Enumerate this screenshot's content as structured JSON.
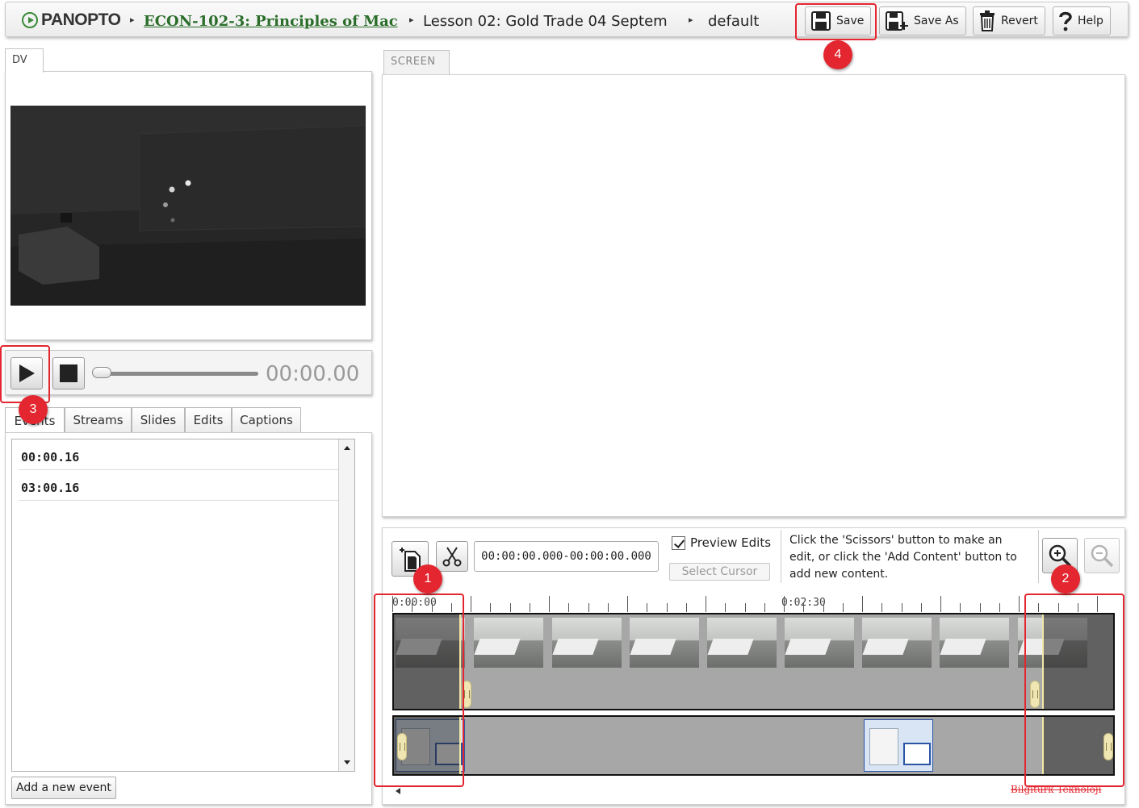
{
  "header": {
    "logo_text": "PANOPTO",
    "breadcrumb_course": "ECON-102-3: Principles of Mac",
    "breadcrumb_lesson": "Lesson 02: Gold Trade 04 Septem",
    "breadcrumb_view": "default",
    "separator": "▸",
    "buttons": {
      "save": "Save",
      "save_as": "Save As",
      "revert": "Revert",
      "help": "Help"
    }
  },
  "annotations": [
    "1",
    "2",
    "3",
    "4"
  ],
  "dv_panel": {
    "tab_label": "DV"
  },
  "screen_panel": {
    "tab_label": "SCREEN"
  },
  "player": {
    "time": "00:00.00",
    "position_fraction": 0.0
  },
  "bottom_tabs": [
    "Events",
    "Streams",
    "Slides",
    "Edits",
    "Captions"
  ],
  "events": {
    "items": [
      "00:00.16",
      "03:00.16"
    ],
    "add_button": "Add a new event"
  },
  "timeline": {
    "range_value": "00:00:00.000-00:00:00.000",
    "preview_edits_label": "Preview Edits",
    "preview_edits_checked": true,
    "select_cursor_label": "Select Cursor",
    "hint": "Click the 'Scissors' button to make an edit, or click the 'Add Content' button to add new content.",
    "ruler_labels": [
      "0:00:00",
      "0:02:30"
    ]
  },
  "watermark": "Bilgitürk Teknoloji",
  "icons": {
    "logo": "panopto-play-icon",
    "save": "floppy-disk-icon",
    "save_as": "floppy-plus-icon",
    "revert": "trash-icon",
    "help": "question-icon",
    "play": "play-icon",
    "stop": "stop-icon",
    "add_content": "add-content-icon",
    "scissors": "scissors-icon",
    "zoom_in": "zoom-in-icon",
    "zoom_out": "zoom-out-icon"
  },
  "colors": {
    "highlight": "#e3262f",
    "link": "#2a6e2a",
    "track_border": "#111111",
    "track_fill": "#a7a7a7",
    "edit_marker": "#f3e9a6"
  }
}
